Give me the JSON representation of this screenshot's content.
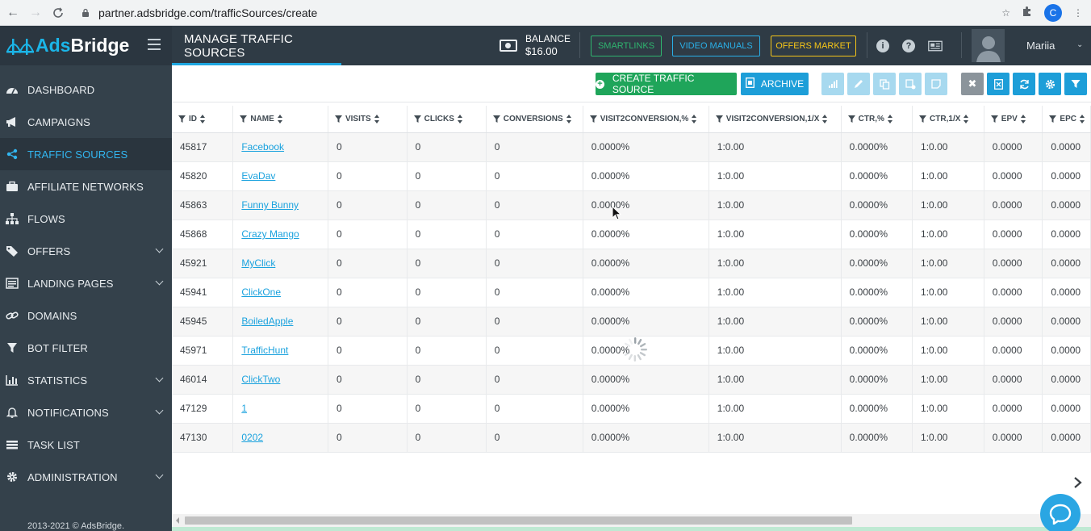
{
  "browser": {
    "url": "partner.adsbridge.com/trafficSources/create",
    "profile_initial": "C"
  },
  "header": {
    "logo_ads": "Ads",
    "logo_bridge": "Bridge",
    "page_title": "MANAGE TRAFFIC SOURCES",
    "balance_label": "BALANCE",
    "balance_value": "$16.00",
    "smartlinks": "SMARTLINKS",
    "video_manuals": "VIDEO MANUALS",
    "offers_market": "OFFERS MARKET",
    "user_name": "Mariia",
    "colors": {
      "header_bg": "#2f3b45",
      "accent": "#1ea7e1",
      "smartlinks": "#2fb56f",
      "video": "#2ab0e8",
      "offers": "#f5c518"
    }
  },
  "sidebar": {
    "items": [
      {
        "label": "DASHBOARD",
        "icon": "dashboard-icon",
        "caret": false,
        "active": false
      },
      {
        "label": "CAMPAIGNS",
        "icon": "megaphone-icon",
        "caret": false,
        "active": false
      },
      {
        "label": "TRAFFIC SOURCES",
        "icon": "share-icon",
        "caret": false,
        "active": true
      },
      {
        "label": "AFFILIATE NETWORKS",
        "icon": "briefcase-icon",
        "caret": false,
        "active": false
      },
      {
        "label": "FLOWS",
        "icon": "sitemap-icon",
        "caret": false,
        "active": false
      },
      {
        "label": "OFFERS",
        "icon": "tags-icon",
        "caret": true,
        "active": false
      },
      {
        "label": "LANDING PAGES",
        "icon": "newspaper-icon",
        "caret": true,
        "active": false
      },
      {
        "label": "DOMAINS",
        "icon": "link-icon",
        "caret": false,
        "active": false
      },
      {
        "label": "BOT FILTER",
        "icon": "filter-icon",
        "caret": false,
        "active": false
      },
      {
        "label": "STATISTICS",
        "icon": "bar-chart-icon",
        "caret": true,
        "active": false
      },
      {
        "label": "NOTIFICATIONS",
        "icon": "bell-icon",
        "caret": true,
        "active": false
      },
      {
        "label": "TASK LIST",
        "icon": "list-icon",
        "caret": false,
        "active": false
      },
      {
        "label": "ADMINISTRATION",
        "icon": "gear-icon",
        "caret": true,
        "active": false
      }
    ],
    "copyright": "2013-2021 © AdsBridge."
  },
  "toolbar": {
    "create_label": "CREATE TRAFFIC SOURCE",
    "archive_label": "ARCHIVE"
  },
  "table": {
    "columns": [
      "ID",
      "NAME",
      "VISITS",
      "CLICKS",
      "CONVERSIONS",
      "VISIT2CONVERSION,%",
      "VISIT2CONVERSION,1/X",
      "CTR,%",
      "CTR,1/X",
      "EPV",
      "EPC"
    ],
    "rows": [
      [
        "45817",
        "Facebook",
        "0",
        "0",
        "0",
        "0.0000%",
        "1:0.00",
        "0.0000%",
        "1:0.00",
        "0.0000",
        "0.0000"
      ],
      [
        "45820",
        "EvaDav",
        "0",
        "0",
        "0",
        "0.0000%",
        "1:0.00",
        "0.0000%",
        "1:0.00",
        "0.0000",
        "0.0000"
      ],
      [
        "45863",
        "Funny Bunny",
        "0",
        "0",
        "0",
        "0.0000%",
        "1:0.00",
        "0.0000%",
        "1:0.00",
        "0.0000",
        "0.0000"
      ],
      [
        "45868",
        "Crazy Mango",
        "0",
        "0",
        "0",
        "0.0000%",
        "1:0.00",
        "0.0000%",
        "1:0.00",
        "0.0000",
        "0.0000"
      ],
      [
        "45921",
        "MyClick",
        "0",
        "0",
        "0",
        "0.0000%",
        "1:0.00",
        "0.0000%",
        "1:0.00",
        "0.0000",
        "0.0000"
      ],
      [
        "45941",
        "ClickOne",
        "0",
        "0",
        "0",
        "0.0000%",
        "1:0.00",
        "0.0000%",
        "1:0.00",
        "0.0000",
        "0.0000"
      ],
      [
        "45945",
        "BoiledApple",
        "0",
        "0",
        "0",
        "0.0000%",
        "1:0.00",
        "0.0000%",
        "1:0.00",
        "0.0000",
        "0.0000"
      ],
      [
        "45971",
        "TrafficHunt",
        "0",
        "0",
        "0",
        "0.0000%",
        "1:0.00",
        "0.0000%",
        "1:0.00",
        "0.0000",
        "0.0000"
      ],
      [
        "46014",
        "ClickTwo",
        "0",
        "0",
        "0",
        "0.0000%",
        "1:0.00",
        "0.0000%",
        "1:0.00",
        "0.0000",
        "0.0000"
      ],
      [
        "47129",
        "1",
        "0",
        "0",
        "0",
        "0.0000%",
        "1:0.00",
        "0.0000%",
        "1:0.00",
        "0.0000",
        "0.0000"
      ],
      [
        "47130",
        "0202",
        "0",
        "0",
        "0",
        "0.0000%",
        "1:0.00",
        "0.0000%",
        "1:0.00",
        "0.0000",
        "0.0000"
      ]
    ]
  }
}
